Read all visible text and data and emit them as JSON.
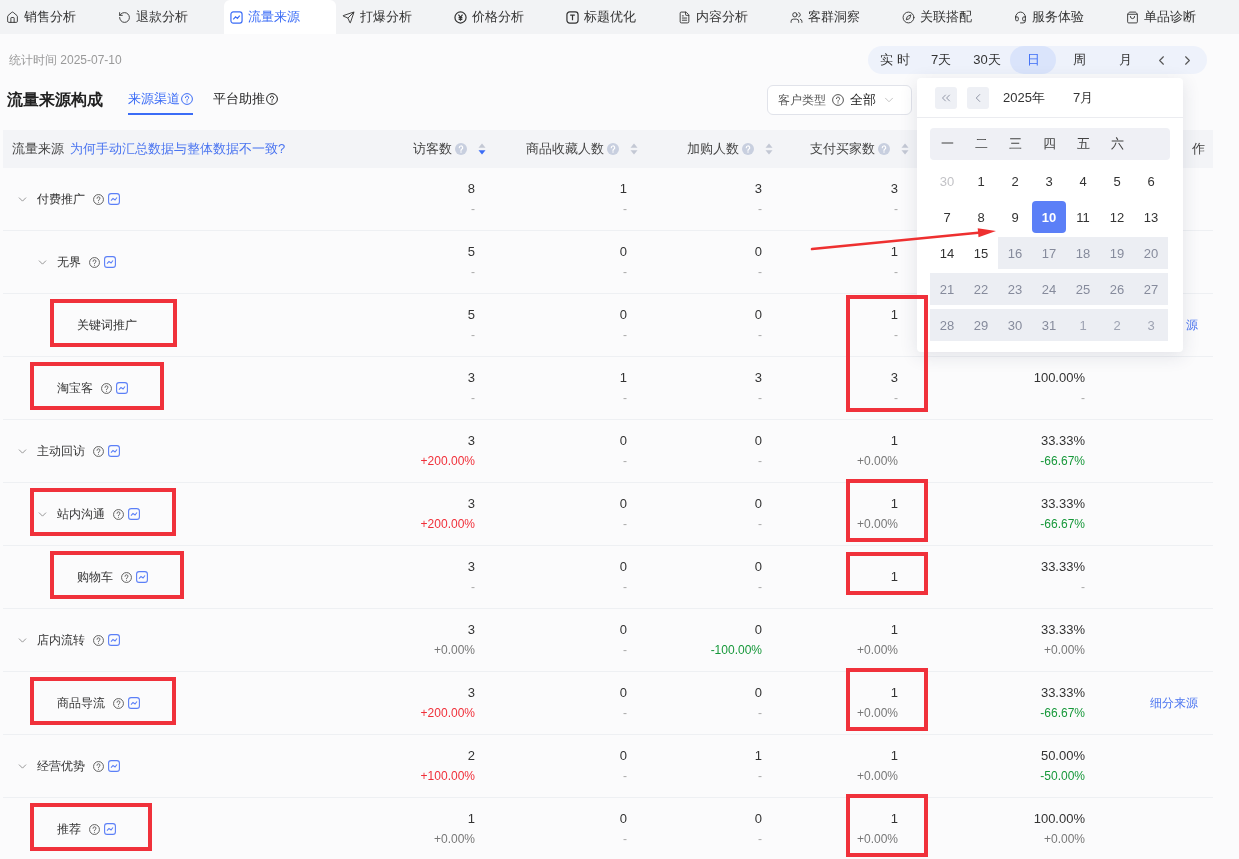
{
  "tabs": [
    {
      "label": "销售分析",
      "selected": false
    },
    {
      "label": "退款分析",
      "selected": false
    },
    {
      "label": "流量来源",
      "selected": true
    },
    {
      "label": "打爆分析",
      "selected": false
    },
    {
      "label": "价格分析",
      "selected": false
    },
    {
      "label": "标题优化",
      "selected": false
    },
    {
      "label": "内容分析",
      "selected": false
    },
    {
      "label": "客群洞察",
      "selected": false
    },
    {
      "label": "关联搭配",
      "selected": false
    },
    {
      "label": "服务体验",
      "selected": false
    },
    {
      "label": "单品诊断",
      "selected": false
    }
  ],
  "stat_time": "统计时间 2025-07-10",
  "periods": [
    {
      "label": "实 时",
      "selected": false
    },
    {
      "label": "7天",
      "selected": false
    },
    {
      "label": "30天",
      "selected": false
    },
    {
      "label": "日",
      "selected": true
    },
    {
      "label": "周",
      "selected": false
    },
    {
      "label": "月",
      "selected": false
    }
  ],
  "section": {
    "title": "流量来源构成",
    "tabs": [
      {
        "label": "来源渠道",
        "selected": true
      },
      {
        "label": "平台助推",
        "selected": false
      }
    ]
  },
  "customer_filter": {
    "label": "客户类型",
    "value": "全部"
  },
  "table": {
    "header": {
      "source": "流量来源",
      "note_link": "为何手动汇总数据与整体数据不一致?",
      "metrics": [
        {
          "label": "访客数",
          "sorted": true
        },
        {
          "label": "商品收藏人数",
          "sorted": false
        },
        {
          "label": "加购人数",
          "sorted": false
        },
        {
          "label": "支付买家数",
          "sorted": false
        }
      ],
      "column_7": "作"
    },
    "rows": [
      {
        "name": "付费推广",
        "expanded": true,
        "icons": true,
        "highlighted": false,
        "metrics": [
          {
            "value": "8",
            "change": "-",
            "kind": "none"
          },
          {
            "value": "1",
            "change": "-",
            "kind": "none"
          },
          {
            "value": "3",
            "change": "-",
            "kind": "none"
          },
          {
            "value": "3",
            "change": "-",
            "kind": "none"
          }
        ],
        "children": [
          {
            "name": "无界",
            "expanded": true,
            "icons": true,
            "highlighted": false,
            "metrics": [
              {
                "value": "5",
                "change": "-",
                "kind": "none"
              },
              {
                "value": "0",
                "change": "-",
                "kind": "none"
              },
              {
                "value": "0",
                "change": "-",
                "kind": "none"
              },
              {
                "value": "1",
                "change": "-",
                "kind": "none"
              }
            ],
            "children": [
              {
                "name": "关键词推广",
                "icons": false,
                "highlighted": true,
                "metrics": [
                  {
                    "value": "5",
                    "change": "-",
                    "kind": "none"
                  },
                  {
                    "value": "0",
                    "change": "-",
                    "kind": "none"
                  },
                  {
                    "value": "0",
                    "change": "-",
                    "kind": "none"
                  },
                  {
                    "value": "1",
                    "change": "-",
                    "kind": "none",
                    "highlighted": true,
                    "open_bottom": true
                  }
                ],
                "action": "源"
              }
            ]
          },
          {
            "name": "淘宝客",
            "icons": true,
            "highlighted": true,
            "metrics": [
              {
                "value": "3",
                "change": "-",
                "kind": "none"
              },
              {
                "value": "1",
                "change": "-",
                "kind": "none"
              },
              {
                "value": "3",
                "change": "-",
                "kind": "none"
              },
              {
                "value": "3",
                "change": "-",
                "kind": "none",
                "highlighted": true,
                "open_top": true
              }
            ],
            "rate": {
              "value": "100.00%",
              "change": "-",
              "kind": "none"
            }
          }
        ]
      },
      {
        "name": "主动回访",
        "expanded": true,
        "icons": true,
        "highlighted": false,
        "metrics": [
          {
            "value": "3",
            "change": "+200.00%",
            "kind": "rise"
          },
          {
            "value": "0",
            "change": "-",
            "kind": "none"
          },
          {
            "value": "0",
            "change": "-",
            "kind": "none"
          },
          {
            "value": "1",
            "change": "+0.00%",
            "kind": "flat"
          }
        ],
        "rate": {
          "value": "33.33%",
          "change": "-66.67%",
          "kind": "fall"
        },
        "children": [
          {
            "name": "站内沟通",
            "expanded": true,
            "icons": true,
            "highlighted": true,
            "metrics": [
              {
                "value": "3",
                "change": "+200.00%",
                "kind": "rise"
              },
              {
                "value": "0",
                "change": "-",
                "kind": "none"
              },
              {
                "value": "0",
                "change": "-",
                "kind": "none"
              },
              {
                "value": "1",
                "change": "+0.00%",
                "kind": "flat",
                "highlighted": true
              }
            ],
            "rate": {
              "value": "33.33%",
              "change": "-66.67%",
              "kind": "fall"
            },
            "children": [
              {
                "name": "购物车",
                "icons": true,
                "highlighted": true,
                "metrics": [
                  {
                    "value": "3",
                    "change": "-",
                    "kind": "none"
                  },
                  {
                    "value": "0",
                    "change": "-",
                    "kind": "none"
                  },
                  {
                    "value": "0",
                    "change": "-",
                    "kind": "none"
                  },
                  {
                    "value": "1",
                    "highlighted": true
                  }
                ],
                "rate": {
                  "value": "33.33%",
                  "change": "-",
                  "kind": "none"
                }
              }
            ]
          }
        ]
      },
      {
        "name": "店内流转",
        "expanded": true,
        "icons": true,
        "highlighted": false,
        "metrics": [
          {
            "value": "3",
            "change": "+0.00%",
            "kind": "flat"
          },
          {
            "value": "0",
            "change": "-",
            "kind": "none"
          },
          {
            "value": "0",
            "change": "-100.00%",
            "kind": "fall"
          },
          {
            "value": "1",
            "change": "+0.00%",
            "kind": "flat"
          }
        ],
        "rate": {
          "value": "33.33%",
          "change": "+0.00%",
          "kind": "flat"
        },
        "children": [
          {
            "name": "商品导流",
            "icons": true,
            "highlighted": true,
            "metrics": [
              {
                "value": "3",
                "change": "+200.00%",
                "kind": "rise"
              },
              {
                "value": "0",
                "change": "-",
                "kind": "none"
              },
              {
                "value": "0",
                "change": "-",
                "kind": "none"
              },
              {
                "value": "1",
                "change": "+0.00%",
                "kind": "flat",
                "highlighted": true
              }
            ],
            "rate": {
              "value": "33.33%",
              "change": "-66.67%",
              "kind": "fall"
            },
            "action": "细分来源"
          }
        ]
      },
      {
        "name": "经营优势",
        "expanded": true,
        "icons": true,
        "highlighted": false,
        "metrics": [
          {
            "value": "2",
            "change": "+100.00%",
            "kind": "rise"
          },
          {
            "value": "0",
            "change": "-",
            "kind": "none"
          },
          {
            "value": "1",
            "change": "-",
            "kind": "none"
          },
          {
            "value": "1",
            "change": "+0.00%",
            "kind": "flat"
          }
        ],
        "rate": {
          "value": "50.00%",
          "change": "-50.00%",
          "kind": "fall"
        },
        "children": [
          {
            "name": "推荐",
            "icons": true,
            "highlighted": true,
            "metrics": [
              {
                "value": "1",
                "change": "+0.00%",
                "kind": "flat"
              },
              {
                "value": "0",
                "change": "-",
                "kind": "none"
              },
              {
                "value": "0",
                "change": "-",
                "kind": "none"
              },
              {
                "value": "1",
                "change": "+0.00%",
                "kind": "flat",
                "highlighted": true
              }
            ],
            "rate": {
              "value": "100.00%",
              "change": "+0.00%",
              "kind": "flat"
            }
          }
        ]
      }
    ]
  },
  "calendar": {
    "year": "2025年",
    "month": "7月",
    "weekdays": [
      "一",
      "二",
      "三",
      "四",
      "五",
      "六"
    ],
    "weeks": [
      [
        {
          "day": "30",
          "outside": true,
          "disabled": false,
          "selected": false
        },
        {
          "day": "1",
          "outside": false,
          "disabled": false,
          "selected": false
        },
        {
          "day": "2",
          "outside": false,
          "disabled": false,
          "selected": false
        },
        {
          "day": "3",
          "outside": false,
          "disabled": false,
          "selected": false
        },
        {
          "day": "4",
          "outside": false,
          "disabled": false,
          "selected": false
        },
        {
          "day": "5",
          "outside": false,
          "disabled": false,
          "selected": false
        },
        {
          "day": "6",
          "outside": false,
          "disabled": false,
          "selected": false
        }
      ],
      [
        {
          "day": "7",
          "outside": false,
          "disabled": false,
          "selected": false
        },
        {
          "day": "8",
          "outside": false,
          "disabled": false,
          "selected": false
        },
        {
          "day": "9",
          "outside": false,
          "disabled": false,
          "selected": false
        },
        {
          "day": "10",
          "outside": false,
          "disabled": false,
          "selected": true
        },
        {
          "day": "11",
          "outside": false,
          "disabled": false,
          "selected": false
        },
        {
          "day": "12",
          "outside": false,
          "disabled": false,
          "selected": false
        },
        {
          "day": "13",
          "outside": false,
          "disabled": false,
          "selected": false
        }
      ],
      [
        {
          "day": "14",
          "outside": false,
          "disabled": false,
          "selected": false
        },
        {
          "day": "15",
          "outside": false,
          "disabled": false,
          "selected": false
        },
        {
          "day": "16",
          "outside": false,
          "disabled": true,
          "selected": false
        },
        {
          "day": "17",
          "outside": false,
          "disabled": true,
          "selected": false
        },
        {
          "day": "18",
          "outside": false,
          "disabled": true,
          "selected": false
        },
        {
          "day": "19",
          "outside": false,
          "disabled": true,
          "selected": false
        },
        {
          "day": "20",
          "outside": false,
          "disabled": true,
          "selected": false
        }
      ],
      [
        {
          "day": "21",
          "outside": false,
          "disabled": true,
          "selected": false
        },
        {
          "day": "22",
          "outside": false,
          "disabled": true,
          "selected": false
        },
        {
          "day": "23",
          "outside": false,
          "disabled": true,
          "selected": false
        },
        {
          "day": "24",
          "outside": false,
          "disabled": true,
          "selected": false
        },
        {
          "day": "25",
          "outside": false,
          "disabled": true,
          "selected": false
        },
        {
          "day": "26",
          "outside": false,
          "disabled": true,
          "selected": false
        },
        {
          "day": "27",
          "outside": false,
          "disabled": true,
          "selected": false
        }
      ],
      [
        {
          "day": "28",
          "outside": false,
          "disabled": true,
          "selected": false
        },
        {
          "day": "29",
          "outside": false,
          "disabled": true,
          "selected": false
        },
        {
          "day": "30",
          "outside": false,
          "disabled": true,
          "selected": false
        },
        {
          "day": "31",
          "outside": false,
          "disabled": true,
          "selected": false
        },
        {
          "day": "1",
          "outside": true,
          "disabled": true,
          "selected": false
        },
        {
          "day": "2",
          "outside": true,
          "disabled": true,
          "selected": false
        },
        {
          "day": "3",
          "outside": true,
          "disabled": true,
          "selected": false
        }
      ]
    ]
  }
}
